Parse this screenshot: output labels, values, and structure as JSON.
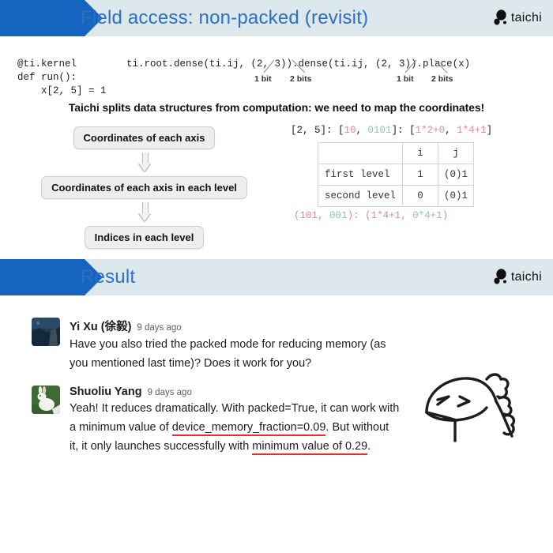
{
  "slide1": {
    "banner": {
      "title": "Field access: non-packed (revisit)",
      "logo_text": "taichi",
      "logo_icon": "taichi-logo-icon"
    },
    "code_left": "@ti.kernel\ndef run():\n    x[2, 5] = 1",
    "code_right": "ti.root.dense(ti.ij, (2, 3)).dense(ti.ij, (2, 3)).place(x)",
    "bit_labels": [
      {
        "text": "1 bit"
      },
      {
        "text": "2 bits"
      },
      {
        "text": "1 bit"
      },
      {
        "text": "2 bits"
      }
    ],
    "statement": "Taichi splits data structures from computation: we need to map the coordinates!",
    "flow": [
      "Coordinates of each axis",
      "Coordinates of each axis in each level",
      "Indices in each level"
    ],
    "top_expr": {
      "prefix": "[2, 5]: [",
      "bin_i": "10",
      "sep1": ", ",
      "bin_j": "0101",
      "mid": "]: [",
      "calc_i": "1*2+0",
      "sep2": ", ",
      "calc_j": "1*4+1",
      "suffix": "]"
    },
    "table": {
      "headers": [
        "",
        "i",
        "j"
      ],
      "rows": [
        {
          "label": "first level",
          "i": "1",
          "j": "(0)1",
          "color": "red"
        },
        {
          "label": "second level",
          "i": "0",
          "j": "(0)1",
          "color": "green"
        }
      ]
    },
    "bottom_expr": {
      "open": "(",
      "bits_i": "101",
      "sep1": ", ",
      "bits_j": "001",
      "mid": "): (",
      "calc_i": "1*4+1",
      "sep2": ", ",
      "calc_j": "0*4+1",
      "close": ")"
    },
    "colors": {
      "accent_blue": "#1565c0",
      "banner_bg": "#dce8ec",
      "title_blue": "#2c6fc4",
      "red": "#e8868f",
      "green": "#93c79a"
    }
  },
  "slide2": {
    "banner": {
      "title": "Result",
      "logo_text": "taichi",
      "logo_icon": "taichi-logo-icon"
    },
    "comments": [
      {
        "author": "Yi Xu (徐毅)",
        "time": "9 days ago",
        "avatar": "landscape-photo-avatar",
        "lines": [
          "Have you also tried the packed mode for reducing memory (as",
          "you mentioned last time)? Does it work for you?"
        ]
      },
      {
        "author": "Shuoliu Yang",
        "time": "9 days ago",
        "avatar": "rabbit-photo-avatar",
        "lines_rich": [
          [
            {
              "t": "Yeah! It reduces dramatically. With packed=True, it can work with",
              "u": false
            }
          ],
          [
            {
              "t": "a minimum value of ",
              "u": false
            },
            {
              "t": "device_memory_fraction=0.09",
              "u": true
            },
            {
              "t": ". But without",
              "u": false
            }
          ],
          [
            {
              "t": "it, it only launches successfully with ",
              "u": false
            },
            {
              "t": "minimum value of 0.29",
              "u": true
            },
            {
              "t": ".",
              "u": false
            }
          ]
        ]
      }
    ],
    "doodle": "squinting-face-doodle",
    "underline_color": "#ef2b26"
  }
}
